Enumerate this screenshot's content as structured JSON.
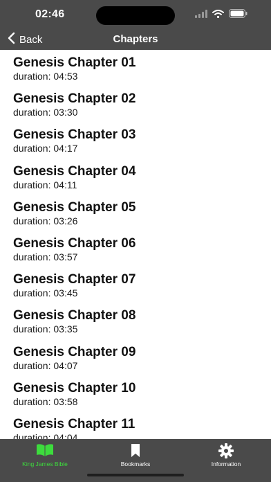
{
  "status_bar": {
    "time": "02:46"
  },
  "nav": {
    "back_label": "Back",
    "title": "Chapters"
  },
  "chapters": [
    {
      "title": "Genesis Chapter 01",
      "duration": "duration: 04:53"
    },
    {
      "title": "Genesis Chapter 02",
      "duration": "duration: 03:30"
    },
    {
      "title": "Genesis Chapter 03",
      "duration": "duration: 04:17"
    },
    {
      "title": "Genesis Chapter 04",
      "duration": "duration: 04:11"
    },
    {
      "title": "Genesis Chapter 05",
      "duration": "duration: 03:26"
    },
    {
      "title": "Genesis Chapter 06",
      "duration": "duration: 03:57"
    },
    {
      "title": "Genesis Chapter 07",
      "duration": "duration: 03:45"
    },
    {
      "title": "Genesis Chapter 08",
      "duration": "duration: 03:35"
    },
    {
      "title": "Genesis Chapter 09",
      "duration": "duration: 04:07"
    },
    {
      "title": "Genesis Chapter 10",
      "duration": "duration: 03:58"
    },
    {
      "title": "Genesis Chapter 11",
      "duration": "duration: 04:04"
    }
  ],
  "tabs": [
    {
      "label": "King James Bible",
      "icon": "book-icon",
      "active": true
    },
    {
      "label": "Bookmarks",
      "icon": "bookmark-icon",
      "active": false
    },
    {
      "label": "Information",
      "icon": "gear-icon",
      "active": false
    }
  ],
  "colors": {
    "bar_background": "#4a4a4a",
    "active_tab": "#3ddc3d"
  }
}
